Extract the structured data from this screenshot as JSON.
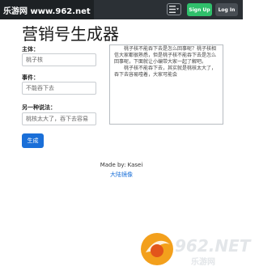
{
  "watermark": {
    "site_badge": "乐游网 www.962.net",
    "logo_text": "962.NET",
    "logo_sub": "乐游网"
  },
  "navbar": {
    "menu_icon": "hamburger-icon",
    "signup_label": "Sign Up",
    "login_label": "Log In"
  },
  "page": {
    "title": "营销号生成器"
  },
  "form": {
    "subject_label": "主体：",
    "subject_placeholder": "桃子核",
    "event_label": "事件：",
    "event_placeholder": "不能吞下去",
    "alt_label": "另一种说法：",
    "alt_placeholder": "桃核太大了，吞下去容易",
    "generate_label": "生成"
  },
  "output": {
    "paragraph_1": "桃子核不能吞下去是怎么回事呢？桃子核相信大家都很熟悉，但是桃子核不能吞下去是怎么回事呢，下面就让小编带大家一起了解吧。",
    "paragraph_2": "桃子核不能吞下去，其实就是桃核太大了，吞下去容易噎着，大家可能会"
  },
  "footer": {
    "credit": "Made by: Kasei",
    "link": "大陆镜像"
  },
  "colors": {
    "navbar": "#2b3035",
    "signup": "#2fbf6b",
    "login": "#474d53",
    "primary": "#1a6fd8"
  }
}
